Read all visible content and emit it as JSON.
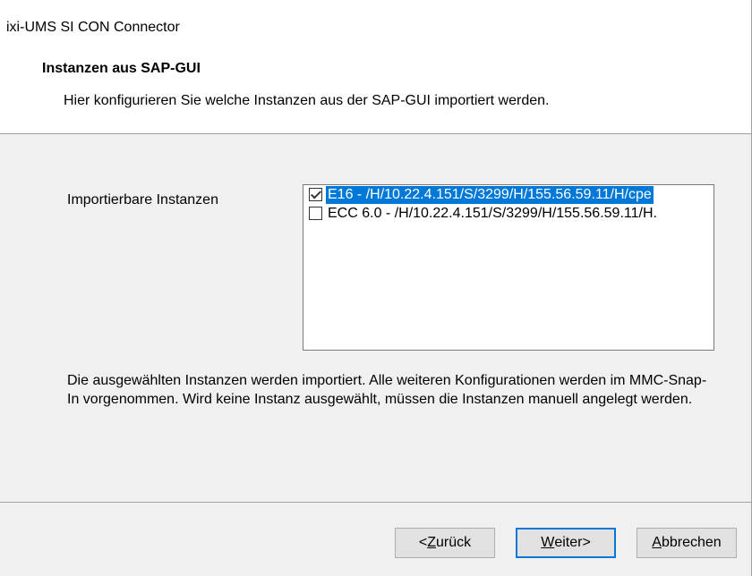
{
  "window": {
    "title": "ixi-UMS SI CON Connector"
  },
  "header": {
    "heading": "Instanzen aus SAP-GUI",
    "subheading": "Hier konfigurieren Sie welche Instanzen aus der SAP-GUI importiert werden."
  },
  "content": {
    "field_label": "Importierbare Instanzen",
    "instances": [
      {
        "label": "E16 - /H/10.22.4.151/S/3299/H/155.56.59.11/H/cpe",
        "checked": true,
        "selected": true
      },
      {
        "label": "ECC 6.0 - /H/10.22.4.151/S/3299/H/155.56.59.11/H.",
        "checked": false,
        "selected": false
      }
    ],
    "description": "Die ausgewählten Instanzen werden importiert. Alle weiteren Konfigurationen werden im MMC-Snap-In vorgenommen. Wird keine Instanz ausgewählt, müssen die Instanzen manuell angelegt werden."
  },
  "footer": {
    "back": {
      "mnemonic": "Z",
      "rest": "urück",
      "prefix": "<"
    },
    "next": {
      "mnemonic": "W",
      "rest": "eiter>",
      "prefix": ""
    },
    "cancel": {
      "mnemonic": "A",
      "rest": "bbrechen",
      "prefix": ""
    }
  },
  "colors": {
    "selection": "#0078d7",
    "default_button_border": "#0078d7"
  }
}
